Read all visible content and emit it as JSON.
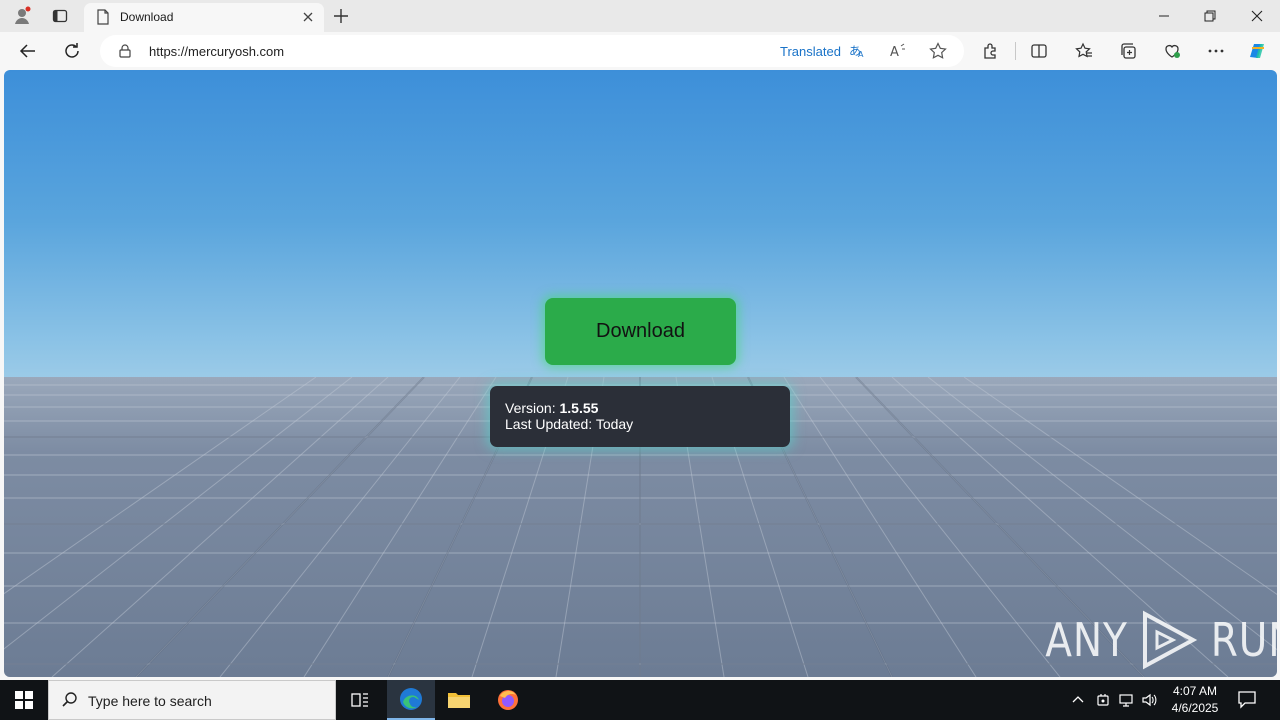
{
  "browser": {
    "tab": {
      "title": "Download"
    },
    "address": {
      "url": "https://mercuryosh.com",
      "translated_label": "Translated"
    }
  },
  "page": {
    "download_button": {
      "label": "Download"
    },
    "info": {
      "version_label": "Version:",
      "version_value": "1.5.55",
      "updated_label": "Last Updated:",
      "updated_value": "Today"
    },
    "watermark": {
      "left": "ANY",
      "right": "RUN"
    }
  },
  "taskbar": {
    "search_placeholder": "Type here to search",
    "time": "4:07 AM",
    "date": "4/6/2025"
  },
  "colors": {
    "download_button": "#2bab4a",
    "info_panel": "#2b2f38",
    "accent_link": "#1a73c8",
    "taskbar": "#101316"
  }
}
